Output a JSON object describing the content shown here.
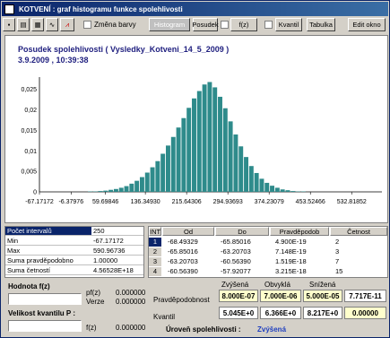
{
  "window": {
    "title": "KOTVENÍ :  graf histogramu funkce spolehlivosti"
  },
  "toolbar": {
    "zmena_barvy": "Změna barvy",
    "histogram": "Histogram",
    "posudek": "Posudek",
    "fz": "f(z)",
    "kvantil": "Kvantil",
    "tabulka": "Tabulka",
    "edit_okno": "Edit okno"
  },
  "chart": {
    "title": "Posudek spolehlivosti ( Vysledky_Kotveni_14_5_2009 )",
    "datetime": "3.9.2009 , 10:39:38"
  },
  "chart_data": {
    "type": "bar",
    "yticks": [
      "0",
      "0,005",
      "0,01",
      "0,015",
      "0,02",
      "0,025"
    ],
    "xticks": [
      "-67.17172",
      "-6.37976",
      "59.69846",
      "136.34930",
      "215.64306",
      "294.93693",
      "374.23079",
      "453.52466",
      "532.81852"
    ],
    "ylim": [
      0,
      0.028
    ],
    "xlim": [
      -67.17172,
      590.96736
    ],
    "color": "#2e8b8b",
    "x": [
      -60,
      -50,
      -40,
      -30,
      -20,
      -10,
      0,
      10,
      20,
      30,
      40,
      50,
      60,
      70,
      80,
      90,
      100,
      110,
      120,
      130,
      140,
      150,
      160,
      170,
      180,
      190,
      200,
      210,
      220,
      230,
      240,
      250,
      260,
      270,
      280,
      290,
      300,
      310,
      320,
      330,
      340,
      350,
      360,
      370,
      380,
      390,
      400,
      410,
      420,
      430,
      440,
      450,
      460,
      470,
      480,
      490,
      500,
      510,
      520,
      530
    ],
    "values": [
      0,
      0,
      0,
      0,
      0,
      0,
      0,
      0,
      0,
      0.0001,
      0.0001,
      0.0002,
      0.0003,
      0.0005,
      0.0007,
      0.001,
      0.0014,
      0.002,
      0.0027,
      0.0036,
      0.0047,
      0.006,
      0.0075,
      0.0093,
      0.0113,
      0.0134,
      0.0157,
      0.018,
      0.0205,
      0.0228,
      0.0246,
      0.0262,
      0.0268,
      0.0255,
      0.0232,
      0.0204,
      0.0172,
      0.014,
      0.0111,
      0.0085,
      0.0063,
      0.0046,
      0.0032,
      0.0022,
      0.0015,
      0.001,
      0.0006,
      0.0004,
      0.0002,
      0.0001,
      0.0001,
      0,
      0,
      0,
      0,
      0,
      0,
      0,
      0,
      0
    ]
  },
  "stats": [
    {
      "k": "Počet intervalů",
      "v": "250"
    },
    {
      "k": "Min",
      "v": "-67.17172"
    },
    {
      "k": "Max",
      "v": "590.96736"
    },
    {
      "k": "Suma pravděpodobno",
      "v": "1.00000"
    },
    {
      "k": "Suma četností",
      "v": "4.56528E+18"
    }
  ],
  "int_table": {
    "headers": [
      "INT",
      "Od",
      "Do",
      "Pravděpodob",
      "Četnost"
    ],
    "rows": [
      [
        "1",
        "-68.49329",
        "-65.85016",
        "4.900E-19",
        "2"
      ],
      [
        "2",
        "-65.85016",
        "-63.20703",
        "7.148E-19",
        "3"
      ],
      [
        "3",
        "-63.20703",
        "-60.56390",
        "1.519E-18",
        "7"
      ],
      [
        "4",
        "-60.56390",
        "-57.92077",
        "3.215E-18",
        "15"
      ]
    ]
  },
  "left_panel": {
    "hodnota": "Hodnota f(z)",
    "fz": "pf(z)",
    "fz_val": "0.000000",
    "verze": "Verze",
    "verze_val": "0.000000",
    "velikost": "Velikost kvantilu P :",
    "fz2": "f(z)",
    "fz2_val": "0.000000"
  },
  "right_panel": {
    "headers": [
      "Zvýšená",
      "Obvyklá",
      "Snížená"
    ],
    "prav_label": "Pravděpodobnost",
    "prav": [
      "8.000E-07",
      "7.000E-06",
      "5.000E-05",
      "7.717E-11"
    ],
    "kv_label": "Kvantil",
    "kv": [
      "5.045E+0",
      "6.366E+0",
      "8.217E+0",
      "0.00000"
    ],
    "uroven_label": "Úroveň spolehlivosti :",
    "uroven_val": "Zvýšená"
  }
}
